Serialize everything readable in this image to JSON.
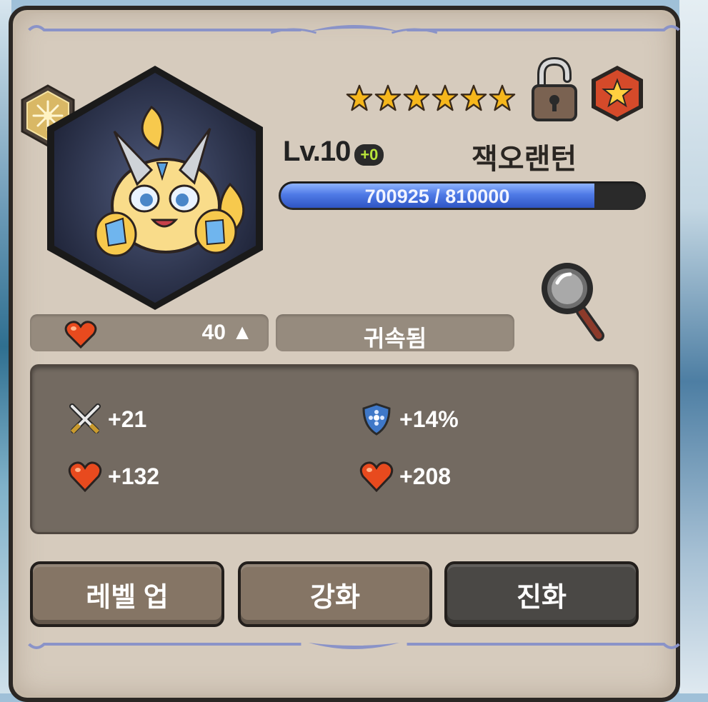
{
  "header": {
    "stars_count": 6,
    "level_label": "Lv.10",
    "enhance_badge": "+0",
    "character_name": "잭오랜턴",
    "icons": [
      "rank-emblem-icon",
      "star-icon",
      "unlocked-padlock-icon",
      "favorite-star-icon",
      "magnifier-icon"
    ]
  },
  "exp": {
    "text": "700925 / 810000",
    "fill_fraction": 0.865
  },
  "info_bar": {
    "affinity_value": "40 ▲",
    "bind_status": "귀속됨"
  },
  "stats": [
    {
      "icon": "crossed-swords-icon",
      "value": "+21"
    },
    {
      "icon": "shield-icon",
      "value": "+14%"
    },
    {
      "icon": "heart-icon",
      "value": "+132"
    },
    {
      "icon": "heart-icon",
      "value": "+208"
    }
  ],
  "buttons": {
    "level_up": "레벨 업",
    "enhance": "강화",
    "evolve": "진화"
  },
  "colors": {
    "panel": "#d6cbbd",
    "exp_fill": "#3f66d8",
    "plus_badge_text": "#b8e33a"
  }
}
